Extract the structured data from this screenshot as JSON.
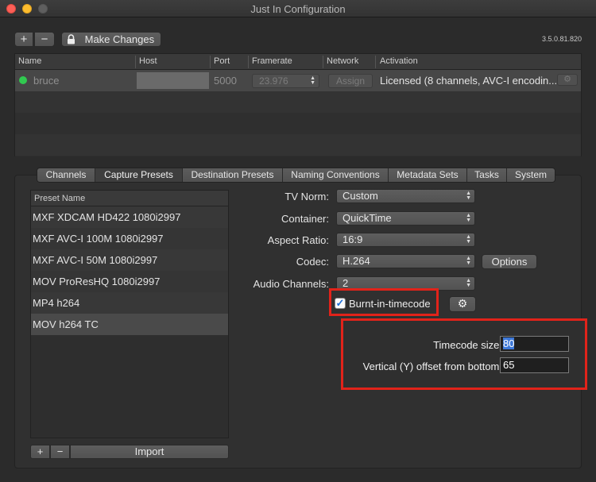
{
  "window": {
    "title": "Just In Configuration"
  },
  "toolbar": {
    "add_label": "+",
    "remove_label": "−",
    "make_changes_label": "Make Changes",
    "version": "3.5.0.81.820"
  },
  "channels_table": {
    "headers": [
      "Name",
      "Host",
      "Port",
      "Framerate",
      "Network",
      "Activation"
    ],
    "rows": [
      {
        "status_color": "#31c950",
        "name": "bruce",
        "host": "",
        "port": "5000",
        "framerate": "23.976",
        "network_button": "Assign",
        "activation": "Licensed (8 channels, AVC-I encodin..."
      }
    ]
  },
  "tabs": [
    {
      "label": "Channels",
      "active": false
    },
    {
      "label": "Capture Presets",
      "active": true
    },
    {
      "label": "Destination Presets",
      "active": false
    },
    {
      "label": "Naming Conventions",
      "active": false
    },
    {
      "label": "Metadata Sets",
      "active": false
    },
    {
      "label": "Tasks",
      "active": false
    },
    {
      "label": "System",
      "active": false
    }
  ],
  "preset_list": {
    "header": "Preset Name",
    "items": [
      "MXF XDCAM HD422 1080i2997",
      "MXF AVC-I 100M 1080i2997",
      "MXF AVC-I 50M 1080i2997",
      "MOV ProResHQ 1080i2997",
      "MP4 h264",
      "MOV h264 TC"
    ],
    "selected": "MOV h264 TC",
    "add_label": "+",
    "remove_label": "−",
    "import_label": "Import"
  },
  "form": {
    "tv_norm": {
      "label": "TV Norm:",
      "value": "Custom"
    },
    "container": {
      "label": "Container:",
      "value": "QuickTime"
    },
    "aspect_ratio": {
      "label": "Aspect Ratio:",
      "value": "16:9"
    },
    "codec": {
      "label": "Codec:",
      "value": "H.264",
      "options_label": "Options"
    },
    "audio_channels": {
      "label": "Audio Channels:",
      "value": "2"
    },
    "burnt_in": {
      "label": "Burnt-in-timecode",
      "checked": true,
      "check_glyph": "✓"
    }
  },
  "popover": {
    "timecode_size": {
      "label": "Timecode size:",
      "value": "80"
    },
    "vertical_offset": {
      "label": "Vertical (Y) offset from bottom:",
      "value": "65"
    }
  },
  "colors": {
    "highlight_red": "#e1231a",
    "status_green": "#31c950",
    "background": "#2b2b2b"
  },
  "icons": {
    "lock": "lock-icon",
    "gear": "gear-icon"
  }
}
